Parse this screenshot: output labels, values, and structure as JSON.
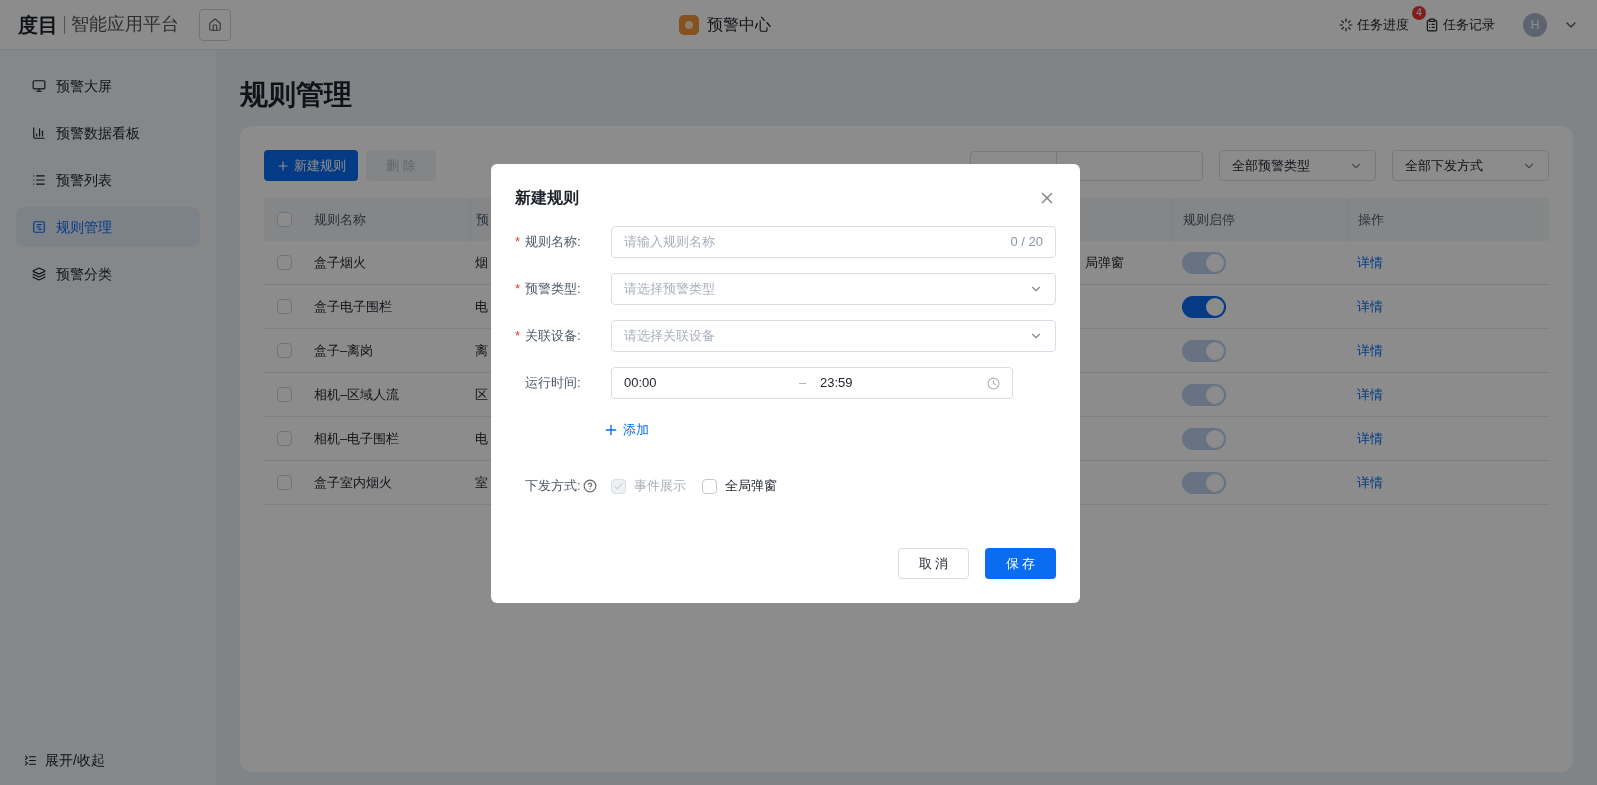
{
  "header": {
    "logo": "度目",
    "platform": "智能应用平台",
    "app_title": "预警中心",
    "actions": [
      {
        "label": "任务进度",
        "badge": "4"
      },
      {
        "label": "任务记录"
      }
    ],
    "avatar": "H"
  },
  "sidebar": {
    "items": [
      {
        "label": "预警大屏",
        "selected": false
      },
      {
        "label": "预警数据看板",
        "selected": false
      },
      {
        "label": "预警列表",
        "selected": false
      },
      {
        "label": "规则管理",
        "selected": true
      },
      {
        "label": "预警分类",
        "selected": false
      }
    ],
    "toggle": "展开/收起"
  },
  "page_title": "规则管理",
  "toolbar": {
    "new_button": "新建规则",
    "delete_button": "删 除",
    "filters": [
      "全部预警类型",
      "全部下发方式"
    ]
  },
  "table": {
    "select_all_checked": false,
    "columns": [
      "规则名称",
      "预",
      "",
      "规则启停",
      "操作"
    ],
    "rows": [
      {
        "checked": false,
        "name": "盒子烟火",
        "type": "烟",
        "delivery": "局弹窗",
        "on": true,
        "disabled": true,
        "action": "详情"
      },
      {
        "checked": false,
        "name": "盒子电子围栏",
        "type": "电",
        "on": true,
        "disabled": false,
        "action": "详情"
      },
      {
        "checked": false,
        "name": "盒子–离岗",
        "type": "离",
        "on": true,
        "disabled": true,
        "action": "详情"
      },
      {
        "checked": false,
        "name": "相机–区域人流",
        "type": "区",
        "on": true,
        "disabled": true,
        "action": "详情"
      },
      {
        "checked": false,
        "name": "相机–电子围栏",
        "type": "电",
        "on": true,
        "disabled": true,
        "action": "详情"
      },
      {
        "checked": false,
        "name": "盒子室内烟火",
        "type": "室",
        "on": true,
        "disabled": true,
        "action": "详情"
      }
    ]
  },
  "dialog": {
    "title": "新建规则",
    "required_mark": "*",
    "fields": [
      {
        "kind": "text",
        "label": "规则名称:",
        "required": true,
        "placeholder": "请输入规则名称",
        "counter": "0 / 20"
      },
      {
        "kind": "select",
        "label": "预警类型:",
        "required": true,
        "placeholder": "请选择预警类型"
      },
      {
        "kind": "select",
        "label": "关联设备:",
        "required": true,
        "placeholder": "请选择关联设备"
      },
      {
        "kind": "timerange",
        "label": "运行时间:",
        "required": false,
        "start": "00:00",
        "separator": "–",
        "end": "23:59"
      }
    ],
    "add_link": "添加",
    "delivery": {
      "label": "下发方式:",
      "options": [
        {
          "label": "事件展示",
          "checked": true,
          "disabled": true
        },
        {
          "label": "全局弹窗",
          "checked": false,
          "disabled": false
        }
      ]
    },
    "buttons": {
      "cancel": "取 消",
      "save": "保 存"
    }
  }
}
